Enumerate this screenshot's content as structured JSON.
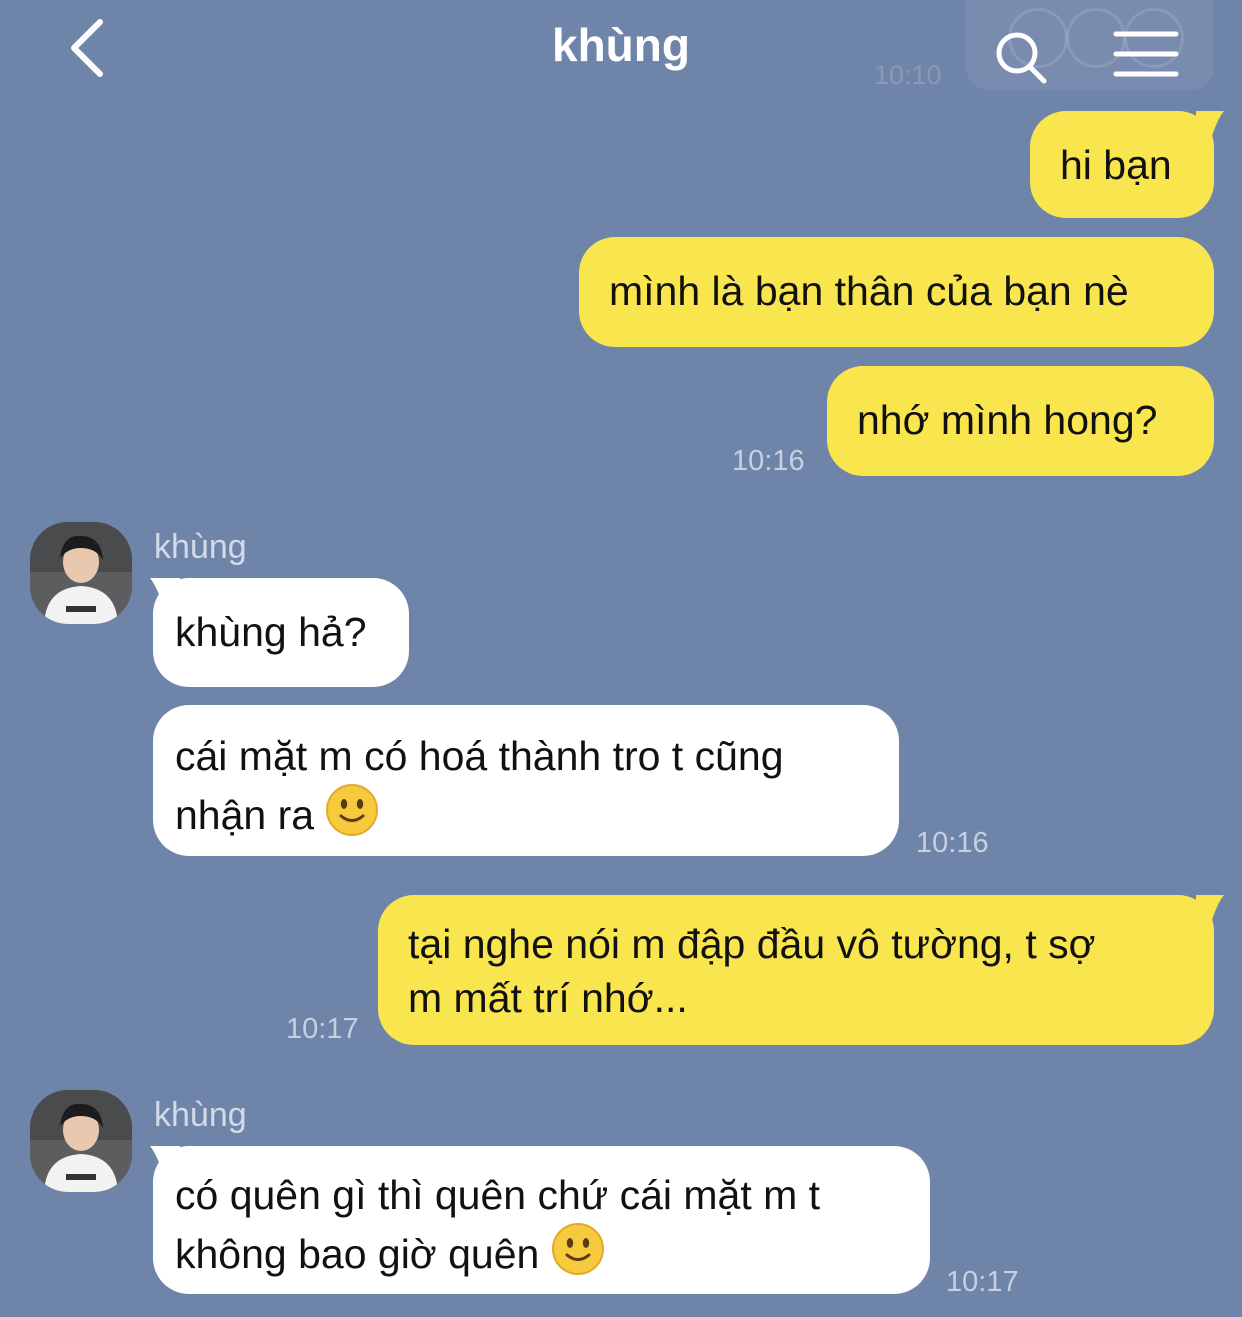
{
  "header": {
    "title": "khùng",
    "faded_time": "10:10"
  },
  "colors": {
    "background": "#6f84a9",
    "my_bubble": "#f9e54e",
    "their_bubble": "#ffffff"
  },
  "messages": [
    {
      "from": "me",
      "text": "hi bạn"
    },
    {
      "from": "me",
      "text": "mình là bạn thân của bạn nè"
    },
    {
      "from": "me",
      "text": "nhớ mình hong?",
      "time": "10:16"
    },
    {
      "from": "them",
      "sender": "khùng",
      "text": "khùng hả?"
    },
    {
      "from": "them",
      "line1": "cái mặt m có hoá thành tro t cũng",
      "line2": "nhận ra",
      "emoji": "slightly-smiling-face-icon",
      "time": "10:16"
    },
    {
      "from": "me",
      "line1": "tại nghe nói m đập đầu vô tường, t sợ",
      "line2": "m mất trí nhớ...",
      "time": "10:17"
    },
    {
      "from": "them",
      "sender": "khùng",
      "line1": "có quên gì thì quên chứ cái mặt m t",
      "line2": "không bao giờ quên",
      "emoji": "slightly-smiling-face-icon",
      "time": "10:17"
    }
  ],
  "icons": {
    "back": "chevron-left-icon",
    "search": "search-icon",
    "menu": "hamburger-menu-icon",
    "avatar": "contact-avatar"
  }
}
